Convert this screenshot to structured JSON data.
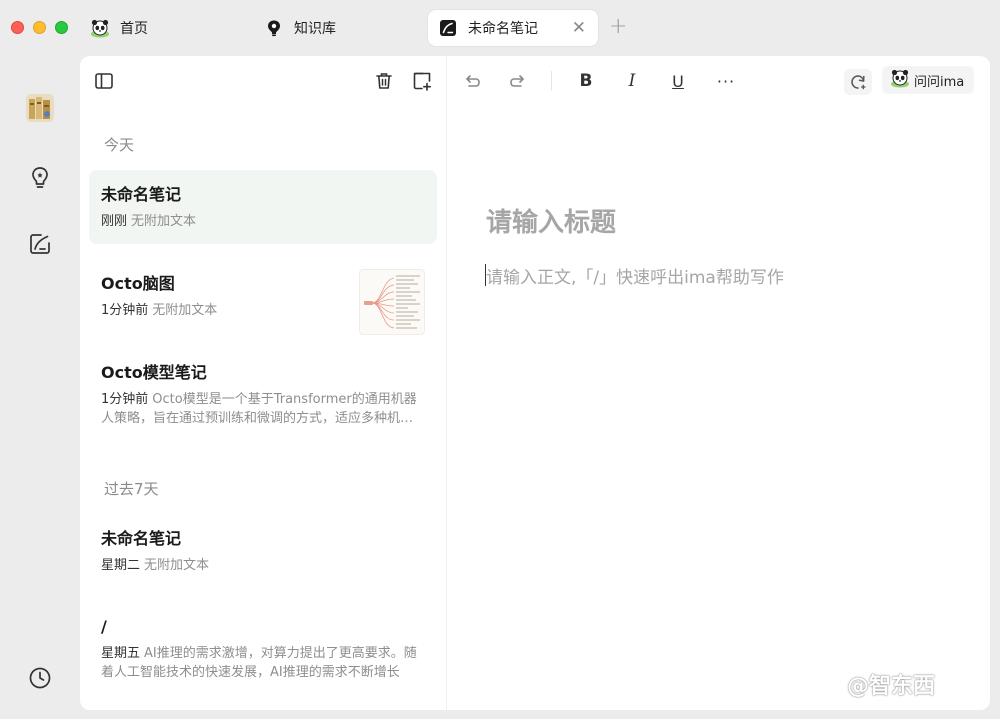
{
  "tabs": [
    {
      "label": "首页",
      "icon": "panda-icon"
    },
    {
      "label": "知识库",
      "icon": "knowledge-base-icon"
    },
    {
      "label": "未命名笔记",
      "icon": "note-icon",
      "active": true
    }
  ],
  "rail": {
    "items": [
      "avatar",
      "bulb-icon",
      "note-edit-icon",
      "clock-icon"
    ]
  },
  "list": {
    "sections": [
      {
        "label": "今天",
        "notes": [
          {
            "title": "未命名笔记",
            "time": "刚刚",
            "preview": "无附加文本",
            "selected": true
          },
          {
            "title": "Octo脑图",
            "time": "1分钟前",
            "preview": "无附加文本",
            "has_thumbnail": true
          },
          {
            "title": "Octo模型笔记",
            "time": "1分钟前",
            "preview": "Octo模型是一个基于Transformer的通用机器人策略，旨在通过预训练和微调的方式，适应多种机器人任务"
          }
        ]
      },
      {
        "label": "过去7天",
        "notes": [
          {
            "title": "未命名笔记",
            "time": "星期二",
            "preview": "无附加文本"
          },
          {
            "title": "/",
            "time": "星期五",
            "preview": "AI推理的需求激增，对算力提出了更高要求。随着人工智能技术的快速发展，AI推理的需求不断增长"
          }
        ]
      }
    ]
  },
  "editor": {
    "title_placeholder": "请输入标题",
    "body_placeholder": "请输入正文,「/」快速呼出ima帮助写作",
    "toolbar": {
      "bold": "B",
      "italic": "I",
      "underline": "U",
      "more": "···",
      "ask_label": "问问ima"
    }
  },
  "watermark": "@智东西",
  "colors": {
    "accent_selected": "#f2f6f3",
    "placeholder": "#a6a6a6",
    "chrome": "#ececec"
  }
}
